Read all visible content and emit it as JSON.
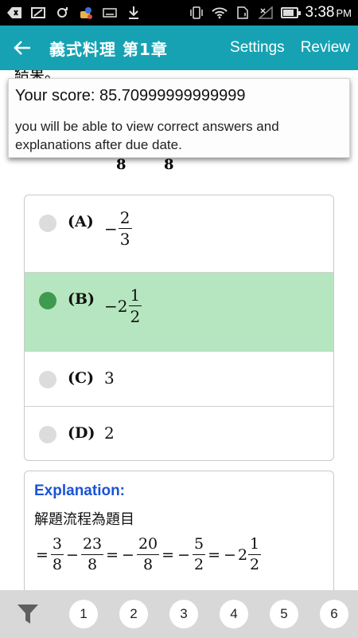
{
  "status_bar": {
    "time": "3:38",
    "ampm": "PM",
    "icons": [
      "back-arrow-icon",
      "image-icon",
      "sync-icon",
      "app-icon",
      "keyboard-icon",
      "download-icon",
      "vibrate-icon",
      "wifi-icon",
      "sim-icon",
      "signal-icon",
      "battery-icon"
    ]
  },
  "app_bar": {
    "title": "義式料理 第1章",
    "settings_label": "Settings",
    "review_label": "Review"
  },
  "question": {
    "partial_top": "結果。",
    "partial_denominators": [
      "8",
      "8"
    ]
  },
  "options": [
    {
      "label": "(A)",
      "sign": "−",
      "whole": "",
      "numerator": "2",
      "denominator": "3",
      "plain": "",
      "selected": false
    },
    {
      "label": "(B)",
      "sign": "−",
      "whole": "2",
      "numerator": "1",
      "denominator": "2",
      "plain": "",
      "selected": true
    },
    {
      "label": "(C)",
      "plain": "3",
      "selected": false
    },
    {
      "label": "(D)",
      "plain": "2",
      "selected": false
    }
  ],
  "explanation": {
    "title": "Explanation:",
    "line": "解題流程為題目",
    "math": {
      "eq": "=",
      "minus": "−",
      "f1": {
        "n": "3",
        "d": "8"
      },
      "f2": {
        "n": "23",
        "d": "8"
      },
      "f3": {
        "n": "20",
        "d": "8"
      },
      "f4": {
        "n": "5",
        "d": "2"
      },
      "whole": "2",
      "f5": {
        "n": "1",
        "d": "2"
      }
    }
  },
  "score_popup": {
    "score": "Your score: 85.70999999999999",
    "message": "you will be able to view correct answers and explanations after due date."
  },
  "bottom_bar": {
    "pages": [
      "1",
      "2",
      "3",
      "4",
      "5",
      "6"
    ]
  },
  "colors": {
    "app_bar": "#16a2b3",
    "selected_option_bg": "#b6e6bf",
    "selected_radio": "#3f9a4f",
    "explanation_title": "#1a53d6"
  }
}
